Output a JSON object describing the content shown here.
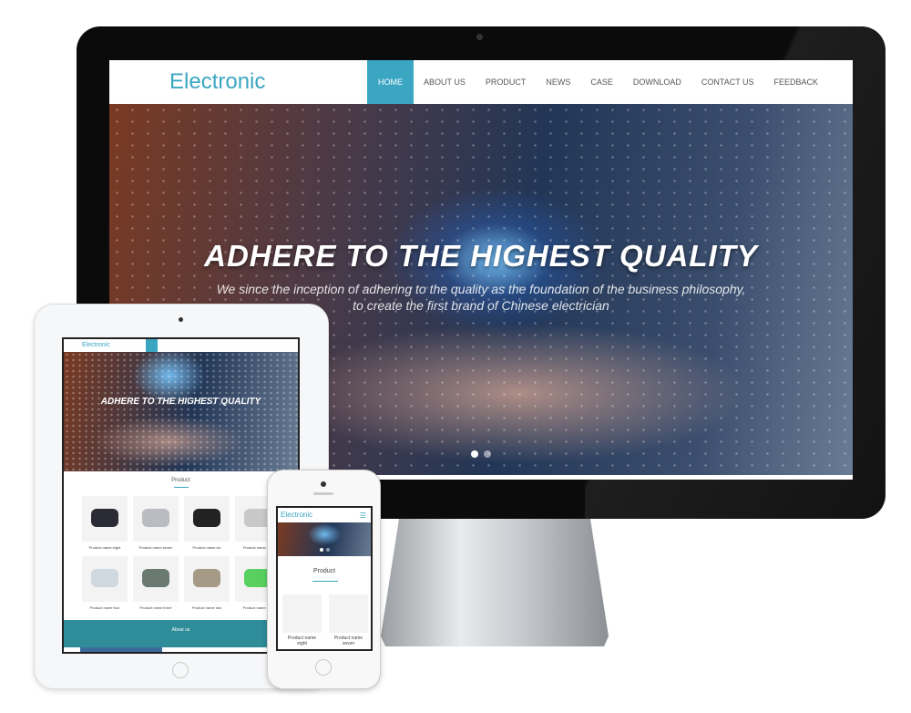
{
  "site": {
    "logo": "Electronic",
    "accent": "#3aa6c2"
  },
  "nav": [
    "HOME",
    "ABOUT US",
    "PRODUCT",
    "NEWS",
    "CASE",
    "DOWNLOAD",
    "CONTACT US",
    "FEEDBACK"
  ],
  "hero": {
    "title": "ADHERE TO THE HIGHEST QUALITY",
    "subtitle_line1": "We since the inception of adhering to the quality as the foundation of the business philosophy,",
    "subtitle_line2": "to create the first brand of Chinese electrician",
    "slides": 2,
    "active_slide": 1
  },
  "product_section": {
    "title": "Product",
    "items": [
      "Product name eight",
      "Product name seven",
      "Product name six",
      "Product name five",
      "Product name four",
      "Product name three",
      "Product name two",
      "Product name one"
    ]
  },
  "about_section": {
    "title": "About us"
  }
}
